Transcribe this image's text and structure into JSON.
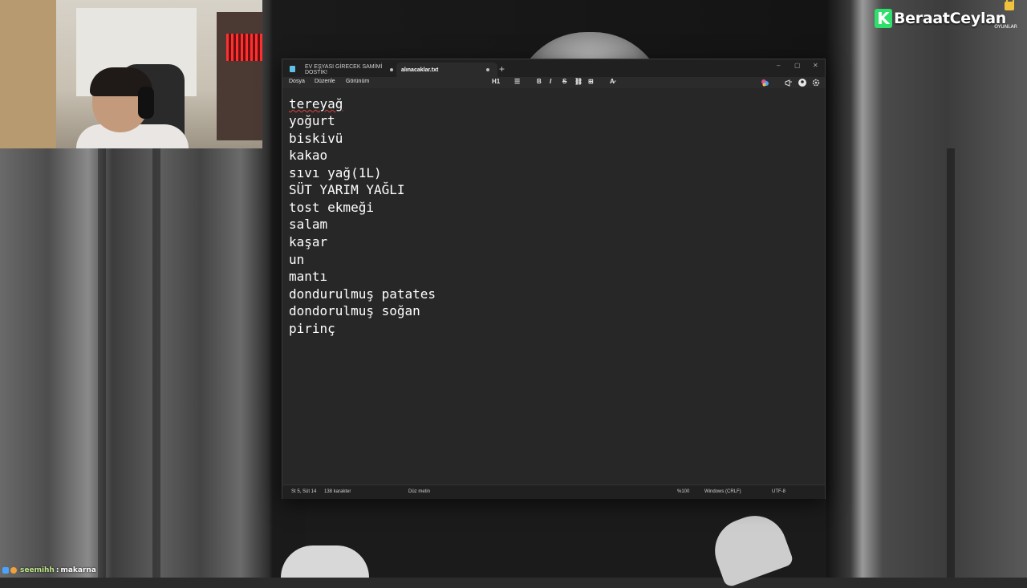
{
  "window": {
    "tabs": [
      {
        "label": "EV EŞYASI GİRECEK SAMİMİ DOSTİK!"
      },
      {
        "label": "alınacaklar.txt"
      }
    ],
    "new_tab": "+",
    "controls": {
      "minimize": "–",
      "maximize": "▢",
      "close": "✕"
    }
  },
  "menubar": {
    "items": [
      "Dosya",
      "Düzenle",
      "Görünüm"
    ],
    "format": {
      "heading": "H1",
      "list": "☰",
      "bold": "B",
      "italic": "I",
      "strike": "S",
      "link": "⛓",
      "table": "⊞",
      "clear": "A̷"
    }
  },
  "document": {
    "lines": [
      "tereyağ",
      "yoğurt",
      "biskivü",
      "kakao",
      "sıvı yağ(1L)",
      "SÜT YARIM YAĞLI",
      "tost ekmeği",
      "salam",
      "kaşar",
      "un",
      "mantı",
      "dondurulmuş patates",
      "dondorulmuş soğan",
      "pirinç"
    ]
  },
  "statusbar": {
    "position": "St 5, Süt 14",
    "characters": "138 karakter",
    "format": "Düz metin",
    "zoom": "%100",
    "line_endings": "Windows (CRLF)",
    "encoding": "UTF-8"
  },
  "overlay": {
    "logo_letter": "K",
    "logo_name": "BeraatCeylan",
    "logo_sub": "OYUNLAR",
    "chat_user": "seemihh",
    "chat_sep": ":",
    "chat_message": "makarna",
    "accent": "#2ee06b"
  }
}
